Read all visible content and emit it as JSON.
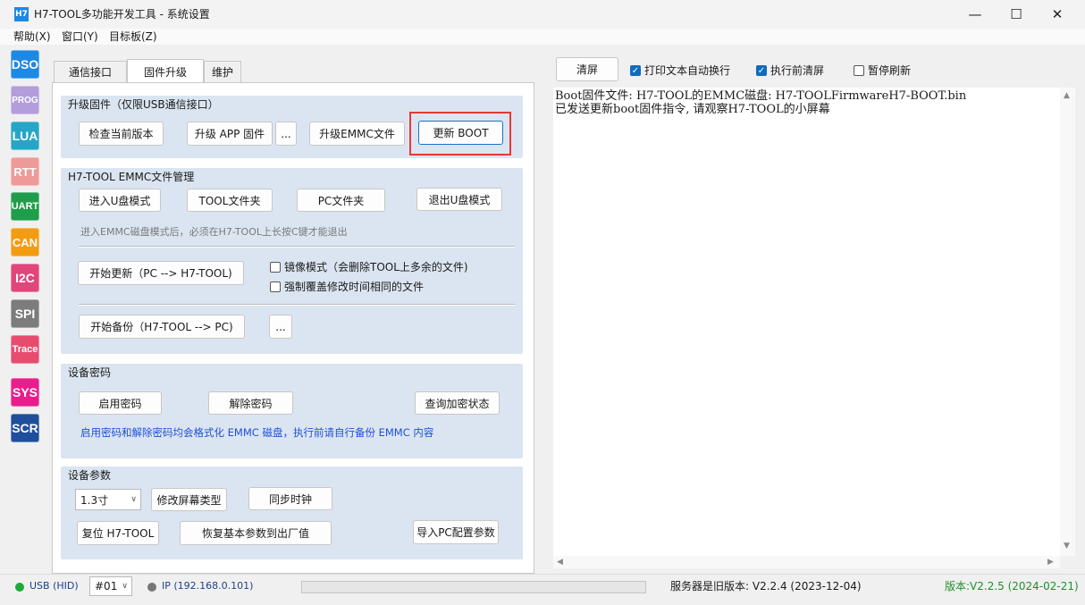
{
  "window": {
    "app_icon_text": "H7",
    "title": "H7-TOOL多功能开发工具 - 系统设置",
    "minimize": "—",
    "maximize": "☐",
    "close": "✕"
  },
  "menu": [
    "帮助(X)",
    "窗口(Y)",
    "目标板(Z)"
  ],
  "rail": [
    {
      "label": "DSO",
      "color": "#1e88e5"
    },
    {
      "label": "PROG",
      "color": "#b39ddb"
    },
    {
      "label": "LUA",
      "color": "#26a6c6"
    },
    {
      "label": "RTT",
      "color": "#ef9a9a"
    },
    {
      "label": "UART",
      "color": "#1e9e4a"
    },
    {
      "label": "CAN",
      "color": "#f39c12"
    },
    {
      "label": "I2C",
      "color": "#e0457b"
    },
    {
      "label": "SPI",
      "color": "#7c7c7c"
    },
    {
      "label": "Trace",
      "color": "#e74c6f"
    },
    {
      "label": "SYS",
      "color": "#e91e8c"
    },
    {
      "label": "SCR",
      "color": "#1f4e9c"
    }
  ],
  "tabs": [
    "通信接口",
    "固件升级",
    "维护"
  ],
  "firmware": {
    "title": "升级固件（仅限USB通信接口）",
    "check_version": "检查当前版本",
    "upgrade_app": "升级 APP 固件",
    "browse": "...",
    "upgrade_emmc": "升级EMMC文件",
    "update_boot": "更新 BOOT"
  },
  "emmc": {
    "title": "H7-TOOL EMMC文件管理",
    "enter_udisk": "进入U盘模式",
    "tool_folder": "TOOL文件夹",
    "pc_folder": "PC文件夹",
    "exit_udisk": "退出U盘模式",
    "hint": "进入EMMC磁盘模式后，必须在H7-TOOL上长按C键才能退出",
    "start_update": "开始更新（PC --> H7-TOOL)",
    "mirror_mode": "镜像模式（会删除TOOL上多余的文件)",
    "force_overwrite": "强制覆盖修改时间相同的文件",
    "start_backup": "开始备份（H7-TOOL --> PC)",
    "browse": "..."
  },
  "password": {
    "title": "设备密码",
    "enable": "启用密码",
    "disable": "解除密码",
    "query": "查询加密状态",
    "note": "启用密码和解除密码均会格式化 EMMC 磁盘，执行前请自行备份 EMMC 内容"
  },
  "params": {
    "title": "设备参数",
    "screen_size": "1.3寸",
    "change_screen": "修改屏幕类型",
    "sync_clock": "同步时钟",
    "reset": "复位 H7-TOOL",
    "restore_default": "恢复基本参数到出厂值",
    "import_pc": "导入PC配置参数"
  },
  "right": {
    "clear": "清屏",
    "wrap_label": "打印文本自动换行",
    "wrap_checked": true,
    "clear_before_label": "执行前清屏",
    "clear_before_checked": true,
    "pause_label": "暂停刷新",
    "pause_checked": false,
    "log": [
      "Boot固件文件: H7-TOOL的EMMC磁盘: H7-TOOLFirmwareH7-BOOT.bin",
      "已发送更新boot固件指令, 请观察H7-TOOL的小屏幕"
    ]
  },
  "status": {
    "usb": "USB (HID)",
    "device_no": "#01",
    "ip": "IP (192.168.0.101)",
    "server_version": "服务器是旧版本: V2.2.4 (2023-12-04)",
    "version": "版本:V2.2.5 (2024-02-21)"
  }
}
